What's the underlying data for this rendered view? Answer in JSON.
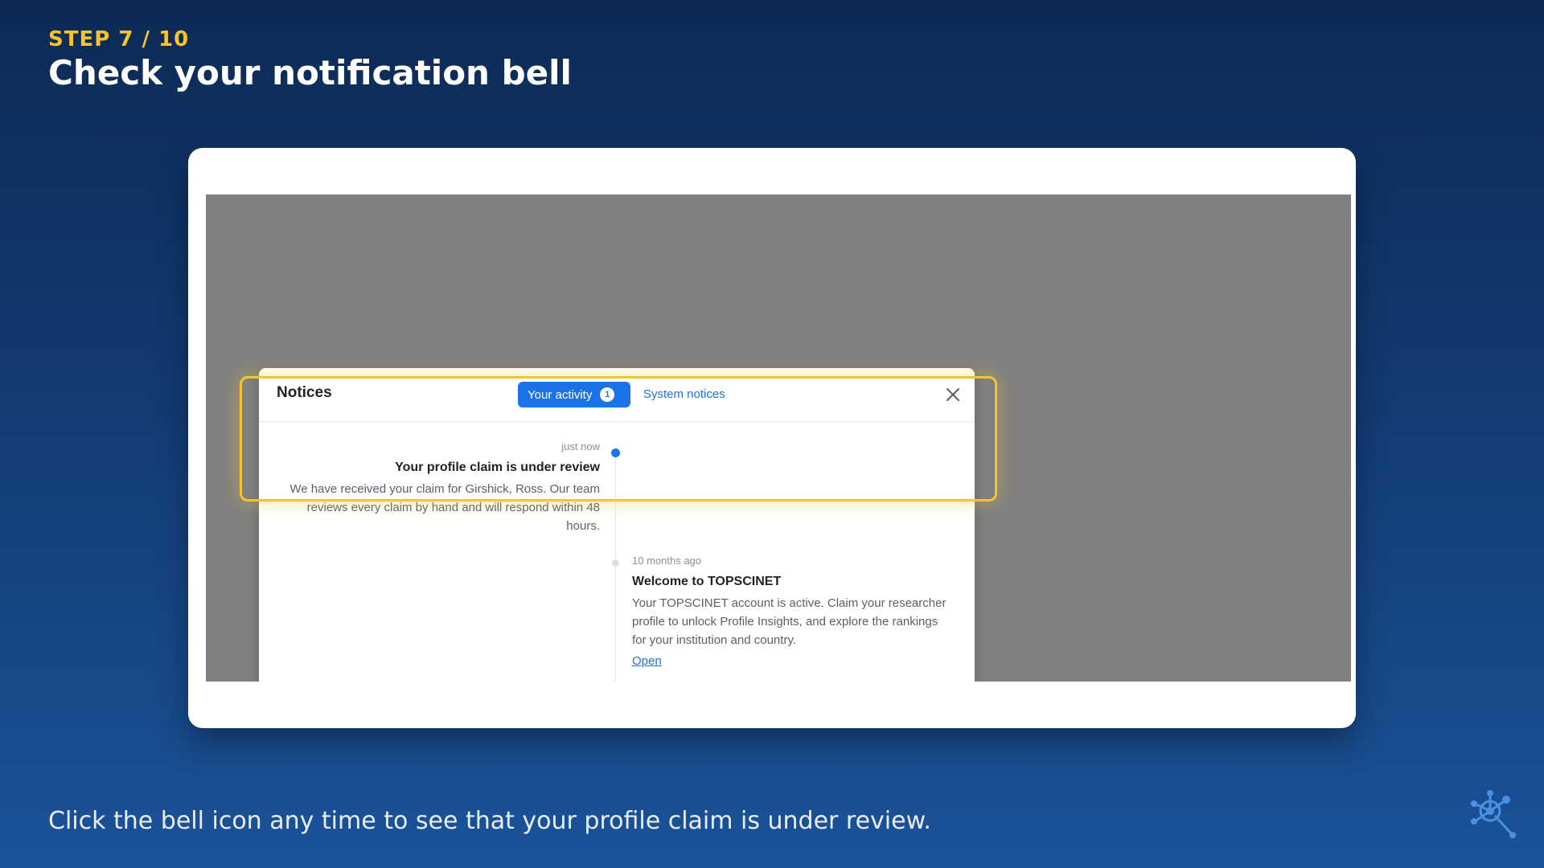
{
  "step": {
    "label": "STEP 7 / 10",
    "title": "Check your notification bell"
  },
  "caption": "Click the bell icon any time to see that your profile claim is under review.",
  "colors": {
    "accent_yellow": "#f4c430",
    "primary_blue": "#1a73e8",
    "background_top": "#0d2a55",
    "background_bottom": "#1b5299",
    "overlay_gray": "#808080"
  },
  "panel": {
    "title": "Notices",
    "tabs": [
      {
        "label": "Your activity",
        "badge": "1",
        "active": true
      },
      {
        "label": "System notices",
        "active": false
      }
    ],
    "close_icon": "close-icon",
    "entries": [
      {
        "time": "just now",
        "title": "Your profile claim is under review",
        "body": "We have received your claim for Girshick, Ross. Our team reviews every claim by hand and will respond within 48 hours."
      },
      {
        "time": "10 months ago",
        "title": "Welcome to TOPSCINET",
        "body": "Your TOPSCINET account is active. Claim your researcher profile to unlock Profile Insights, and explore the rankings for your institution and country.",
        "link": "Open"
      }
    ]
  },
  "logo_icon": "network-search-logo-icon"
}
